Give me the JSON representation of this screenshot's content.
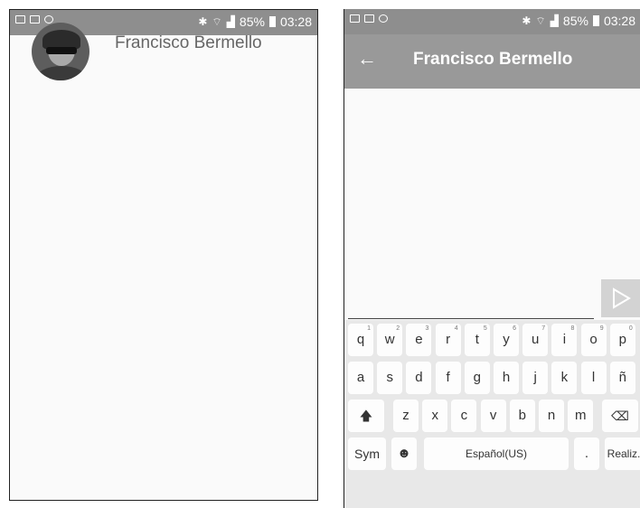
{
  "status_bar": {
    "battery": "85%",
    "time": "03:28"
  },
  "contacts_screen": {
    "contacts": [
      {
        "name": "Francisco Bermello"
      }
    ]
  },
  "chat_screen": {
    "title": "Francisco Bermello",
    "back_icon": "arrow-left-icon",
    "send_icon": "play-triangle-icon"
  },
  "keyboard": {
    "row1": [
      "q",
      "w",
      "e",
      "r",
      "t",
      "y",
      "u",
      "i",
      "o",
      "p"
    ],
    "row1_numbers": [
      "1",
      "2",
      "3",
      "4",
      "5",
      "6",
      "7",
      "8",
      "9",
      "0"
    ],
    "row2": [
      "a",
      "s",
      "d",
      "f",
      "g",
      "h",
      "j",
      "k",
      "l",
      "ñ"
    ],
    "row3": [
      "z",
      "x",
      "c",
      "v",
      "b",
      "n",
      "m"
    ],
    "sym_label": "Sym",
    "space_label": "Español(US)",
    "period_label": ".",
    "action_label": "Realiz."
  }
}
